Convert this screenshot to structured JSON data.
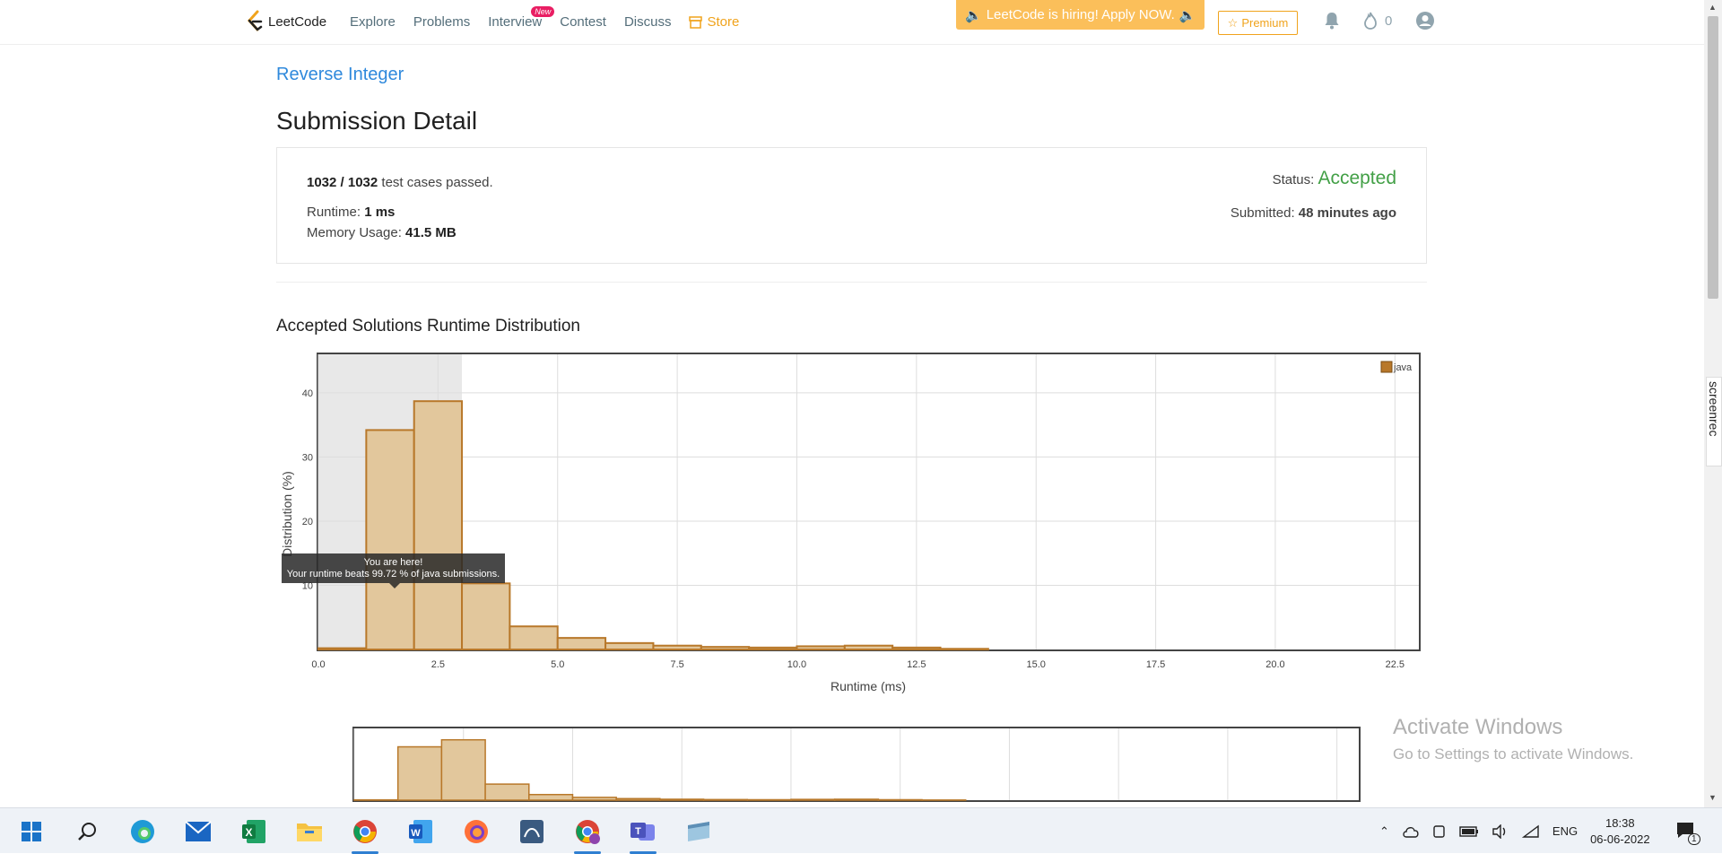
{
  "nav": {
    "logo": "LeetCode",
    "links": [
      "Explore",
      "Problems",
      "Interview",
      "Contest",
      "Discuss",
      "Store"
    ],
    "new_badge": "New",
    "banner": "LeetCode is hiring! Apply NOW.",
    "premium": "Premium",
    "flame_count": "0"
  },
  "problem_title": "Reverse Integer",
  "page_title": "Submission Detail",
  "details": {
    "cases_passed": "1032 / 1032",
    "cases_suffix": "test cases passed.",
    "runtime_label": "Runtime:",
    "runtime_value": "1 ms",
    "memory_label": "Memory Usage:",
    "memory_value": "41.5 MB",
    "status_label": "Status:",
    "status_value": "Accepted",
    "submitted_label": "Submitted:",
    "submitted_value": "48 minutes ago"
  },
  "chart_section_title": "Accepted Solutions Runtime Distribution",
  "tooltip": {
    "line1": "You are here!",
    "line2": "Your runtime beats 99.72 % of java submissions."
  },
  "watermark": {
    "line1": "Activate Windows",
    "line2": "Go to Settings to activate Windows."
  },
  "screenrec": "screenrec",
  "taskbar": {
    "language": "ENG",
    "time": "18:38",
    "date": "06-06-2022",
    "notif_count": "1"
  },
  "colors": {
    "bar_fill": "#e2c79c",
    "bar_stroke": "#b8782a",
    "accepted": "#43a047",
    "link": "#2f89dc",
    "store": "#f0a31c"
  },
  "chart_data": {
    "type": "bar",
    "title": "",
    "xlabel": "Runtime (ms)",
    "ylabel": "Distribution (%)",
    "x_ticks": [
      "0.0",
      "2.5",
      "5.0",
      "7.5",
      "10.0",
      "12.5",
      "15.0",
      "17.5",
      "20.0",
      "22.5"
    ],
    "y_ticks": [
      "10",
      "20",
      "30",
      "40"
    ],
    "xlim": [
      0,
      23
    ],
    "ylim": [
      0,
      46
    ],
    "bin_width": 1,
    "bins_start": [
      0,
      1,
      2,
      3,
      4,
      5,
      6,
      7,
      8,
      9,
      10,
      11,
      12,
      13
    ],
    "series": [
      {
        "name": "java",
        "values": [
          0.2,
          34.2,
          38.7,
          10.3,
          3.6,
          1.8,
          1.0,
          0.6,
          0.4,
          0.3,
          0.5,
          0.6,
          0.3,
          0.1
        ]
      }
    ],
    "highlight_range": [
      0,
      3
    ],
    "legend": "top-right",
    "grid": true,
    "navigator_y_ticks": [
      "20",
      "40"
    ]
  }
}
